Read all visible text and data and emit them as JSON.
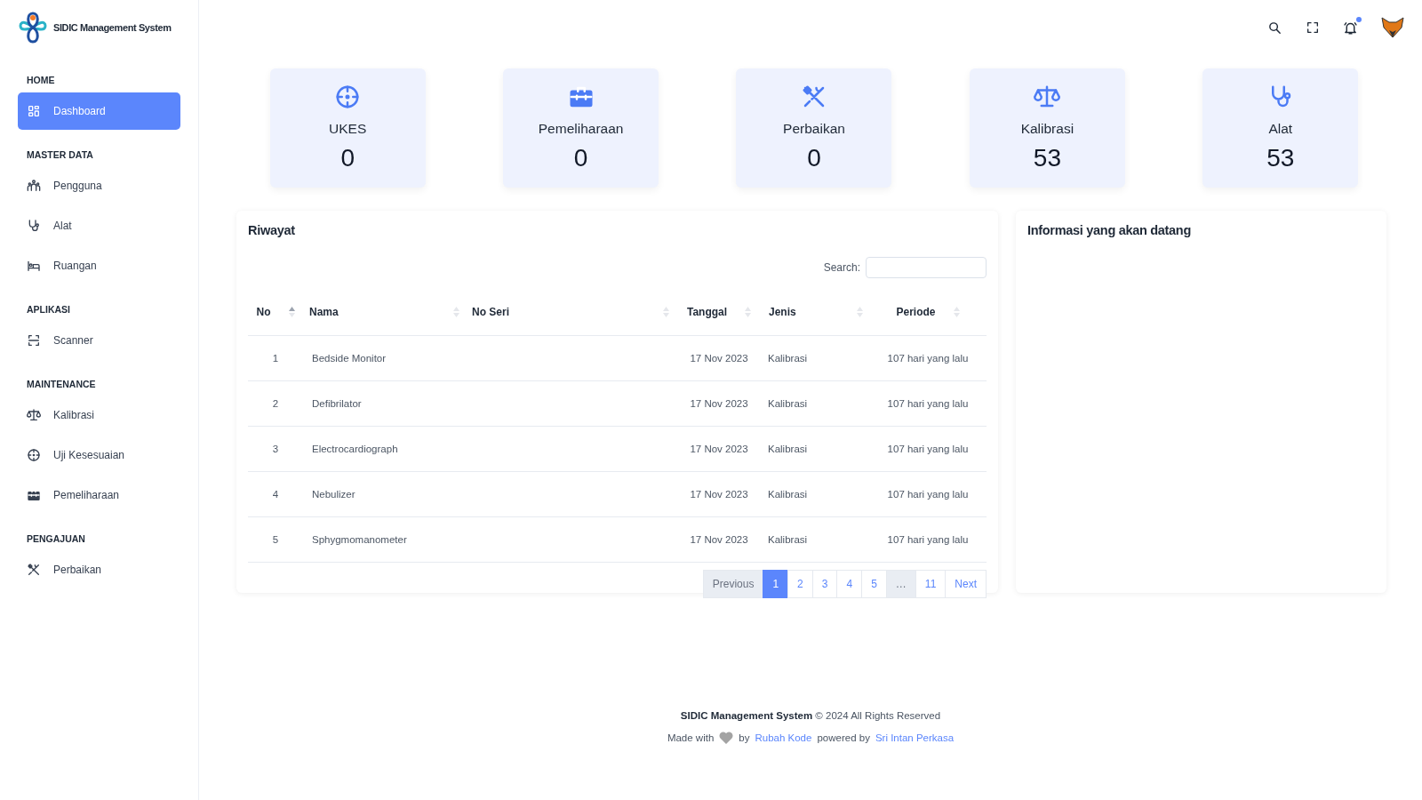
{
  "brand": {
    "name": "SIDIC Management System"
  },
  "sidebar": {
    "sections": [
      {
        "title": "HOME",
        "items": [
          {
            "label": "Dashboard",
            "selected": true
          }
        ]
      },
      {
        "title": "MASTER DATA",
        "items": [
          {
            "label": "Pengguna",
            "selected": false
          },
          {
            "label": "Alat",
            "selected": false
          },
          {
            "label": "Ruangan",
            "selected": false
          }
        ]
      },
      {
        "title": "APLIKASI",
        "items": [
          {
            "label": "Scanner",
            "selected": false
          }
        ]
      },
      {
        "title": "MAINTENANCE",
        "items": [
          {
            "label": "Kalibrasi",
            "selected": false
          },
          {
            "label": "Uji Kesesuaian",
            "selected": false
          },
          {
            "label": "Pemeliharaan",
            "selected": false
          }
        ]
      },
      {
        "title": "PENGAJUAN",
        "items": [
          {
            "label": "Perbaikan",
            "selected": false
          }
        ]
      }
    ]
  },
  "topbar": {
    "notification_dot": true
  },
  "stats": [
    {
      "label": "UKES",
      "value": "0"
    },
    {
      "label": "Pemeliharaan",
      "value": "0"
    },
    {
      "label": "Perbaikan",
      "value": "0"
    },
    {
      "label": "Kalibrasi",
      "value": "53"
    },
    {
      "label": "Alat",
      "value": "53"
    }
  ],
  "riwayat": {
    "title": "Riwayat",
    "search_label": "Search:",
    "columns": [
      {
        "label": "No",
        "sorted": true
      },
      {
        "label": "Nama",
        "sorted": false
      },
      {
        "label": "No Seri",
        "sorted": false
      },
      {
        "label": "Tanggal",
        "sorted": false
      },
      {
        "label": "Jenis",
        "sorted": false
      },
      {
        "label": "Periode",
        "sorted": false
      }
    ],
    "rows": [
      {
        "no": "1",
        "nama": "Bedside Monitor",
        "tanggal": "17 Nov 2023",
        "jenis": "Kalibrasi",
        "periode": "107 hari yang lalu"
      },
      {
        "no": "2",
        "nama": "Defibrilator",
        "tanggal": "17 Nov 2023",
        "jenis": "Kalibrasi",
        "periode": "107 hari yang lalu"
      },
      {
        "no": "3",
        "nama": "Electrocardiograph",
        "tanggal": "17 Nov 2023",
        "jenis": "Kalibrasi",
        "periode": "107 hari yang lalu"
      },
      {
        "no": "4",
        "nama": "Nebulizer",
        "tanggal": "17 Nov 2023",
        "jenis": "Kalibrasi",
        "periode": "107 hari yang lalu"
      },
      {
        "no": "5",
        "nama": "Sphygmomanometer",
        "tanggal": "17 Nov 2023",
        "jenis": "Kalibrasi",
        "periode": "107 hari yang lalu"
      }
    ],
    "pagination": [
      {
        "label": "Previous",
        "selected": false,
        "disabled": true
      },
      {
        "label": "1",
        "selected": true,
        "disabled": false
      },
      {
        "label": "2",
        "selected": false,
        "disabled": false
      },
      {
        "label": "3",
        "selected": false,
        "disabled": false
      },
      {
        "label": "4",
        "selected": false,
        "disabled": false
      },
      {
        "label": "5",
        "selected": false,
        "disabled": false
      },
      {
        "label": "…",
        "selected": false,
        "disabled": true
      },
      {
        "label": "11",
        "selected": false,
        "disabled": false
      },
      {
        "label": "Next",
        "selected": false,
        "disabled": false
      }
    ]
  },
  "upcoming": {
    "title": "Informasi yang akan datang"
  },
  "footer": {
    "copyright": "**SIDIC Management System** © 2024 All Rights Reserved",
    "made_with": "Made with",
    "by": "by",
    "author": "Rubah Kode",
    "powered_by": "powered by",
    "company": "Sri Intan Perkasa"
  }
}
